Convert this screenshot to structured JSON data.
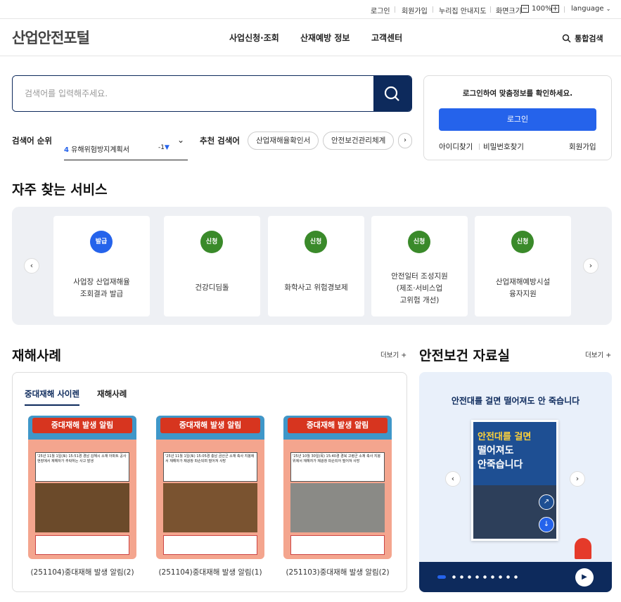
{
  "util": {
    "login": "로그인",
    "join": "회원가입",
    "sitemap": "누리집 안내지도",
    "zoom_label": "화면크기",
    "zoom_minus": "−",
    "zoom_value": "100%",
    "zoom_plus": "+",
    "language": "language"
  },
  "header": {
    "logo": "산업안전포털",
    "menu": [
      "사업신청·조회",
      "산재예방 정보",
      "고객센터"
    ],
    "search_all": "통합검색"
  },
  "search": {
    "placeholder": "검색어를 입력해주세요.",
    "rank_label": "검색어 순위",
    "rank_item": "유해위험방지계획서",
    "rank_change": "-1",
    "recommend_label": "추천 검색어",
    "chips": [
      "산업재해율확인서",
      "안전보건관리체계"
    ]
  },
  "login": {
    "message": "로그인하여 맞춤정보를 확인하세요.",
    "button": "로그인",
    "find_id": "아이디찾기",
    "find_pw": "비밀번호찾기",
    "join": "회원가입"
  },
  "services": {
    "title": "자주 찾는 서비스",
    "items": [
      {
        "badge": "발급",
        "label": "사업장 산업재해율\n조회결과 발급",
        "color": "#2563eb"
      },
      {
        "badge": "신청",
        "label": "건강디딤돌",
        "color": "#3a8a2a"
      },
      {
        "badge": "신청",
        "label": "화학사고 위험경보제",
        "color": "#3a8a2a"
      },
      {
        "badge": "신청",
        "label": "안전일터 조성지원\n(제조·서비스업\n고위험 개선)",
        "color": "#3a8a2a"
      },
      {
        "badge": "신청",
        "label": "산업재해예방시설\n융자지원",
        "color": "#3a8a2a"
      }
    ]
  },
  "cases": {
    "title": "재해사례",
    "more": "더보기",
    "tabs": [
      "중대재해 사이렌",
      "재해사례"
    ],
    "poster_title": "중대재해 발생 알림",
    "items": [
      {
        "caption": "(251104)중대재해 발생 알림(2)",
        "desc": "'25년 11월 1일(토) 15:51경 경남 김해시 소재 아파트 공사 현장에서 재해자가 추락하는 사고 발생"
      },
      {
        "caption": "(251104)중대재해 발생 알림(1)",
        "desc": "'25년 11월 1일(토) 15:05경 충남 금산군 소재 축사 지붕에서 재해자가 채광창 파손되며 떨어져 사망"
      },
      {
        "caption": "(251103)중대재해 발생 알림(2)",
        "desc": "'25년 10월 30일(목) 15:40경 경북 고령군 소재 축사 지붕 위에서 재해자가 채광창 파손되어 떨어져 사망"
      }
    ]
  },
  "resources": {
    "title": "안전보건 자료실",
    "more": "더보기",
    "banner_title": "안전대를 걸면 떨어져도 안 죽습니다",
    "book_line1": "안전대를 걸면",
    "book_line2": "떨어져도",
    "book_line3": "안죽습니다"
  }
}
